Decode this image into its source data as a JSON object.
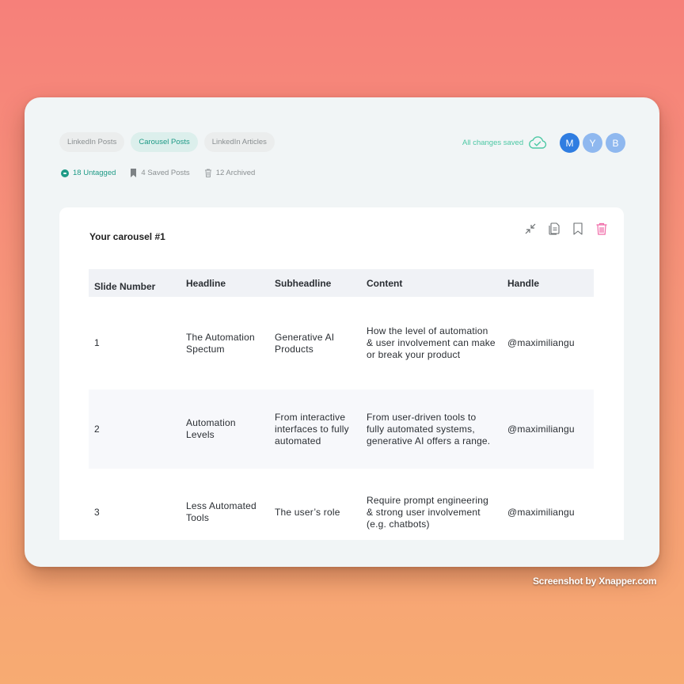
{
  "tabs": [
    {
      "label": "LinkedIn Posts",
      "active": false
    },
    {
      "label": "Carousel Posts",
      "active": true
    },
    {
      "label": "LinkedIn Articles",
      "active": false
    }
  ],
  "stats": {
    "untagged": "18 Untagged",
    "saved": "4 Saved Posts",
    "archived": "12 Archived"
  },
  "status": {
    "saved_text": "All changes saved",
    "icon": "cloud-check-icon"
  },
  "avatars": [
    {
      "initial": "M",
      "color": "#2f7de1"
    },
    {
      "initial": "Y",
      "color": "#8fb8ef"
    },
    {
      "initial": "B",
      "color": "#8fb8ef"
    }
  ],
  "card": {
    "title": "Your carousel #1",
    "actions": [
      "collapse-icon",
      "copy-icon",
      "bookmark-icon",
      "trash-icon"
    ]
  },
  "table": {
    "headers": [
      "Slide Number",
      "Headline",
      "Subheadline",
      "Content",
      "Handle"
    ],
    "rows": [
      [
        "1",
        "The Automation Spectum",
        "Generative AI Products",
        "How the level of automation & user involvement can make or break your product",
        "@maximiliangu"
      ],
      [
        "2",
        "Automation Levels",
        "From interactive interfaces to fully automated",
        "From user-driven tools to fully automated systems, generative AI offers a range.",
        "@maximiliangu"
      ],
      [
        "3",
        "Less Automated Tools",
        "The user’s role",
        "Require prompt engineering & strong user involvement (e.g. chatbots)",
        "@maximiliangu"
      ]
    ]
  },
  "colors": {
    "accent": "#1e9a86",
    "saved": "#4cc8a4",
    "delete": "#f06aa8"
  },
  "watermark": "Screenshot by Xnapper.com"
}
